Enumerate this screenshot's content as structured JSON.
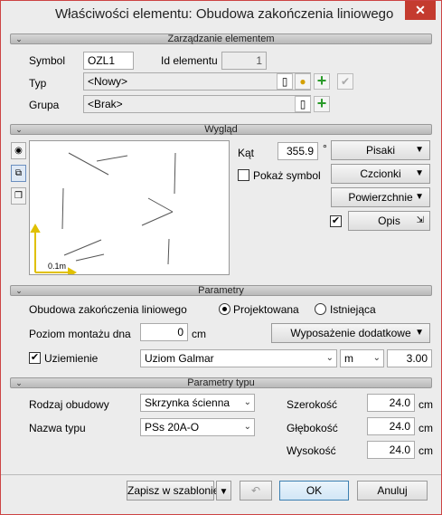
{
  "window": {
    "title": "Właściwości elementu: Obudowa zakończenia liniowego",
    "close": "✕"
  },
  "sections": {
    "management": "Zarządzanie elementem",
    "appearance": "Wygląd",
    "parameters": "Parametry",
    "type_parameters": "Parametry typu"
  },
  "management": {
    "symbol_label": "Symbol",
    "symbol_value": "OZL1",
    "id_label": "Id elementu",
    "id_value": "1",
    "type_label": "Typ",
    "type_value": "<Nowy>",
    "group_label": "Grupa",
    "group_value": "<Brak>"
  },
  "appearance": {
    "angle_label": "Kąt",
    "angle_value": "355.9",
    "angle_unit": "°",
    "show_symbol_label": "Pokaż symbol",
    "show_symbol_checked": false,
    "pens_button": "Pisaki",
    "fonts_button": "Czcionki",
    "surfaces_button": "Powierzchnie",
    "description_button": "Opis",
    "description_checked": true,
    "scale_label": "0.1m"
  },
  "parameters": {
    "enclosure_label": "Obudowa zakończenia liniowego",
    "radio_designed": "Projektowana",
    "radio_existing": "Istniejąca",
    "selected": "Projektowana",
    "mount_level_label": "Poziom montażu dna",
    "mount_level_value": "0",
    "mount_level_unit": "cm",
    "equipment_button": "Wyposażenie dodatkowe",
    "grounding_label": "Uziemienie",
    "grounding_checked": true,
    "grounding_value": "Uziom Galmar",
    "grounding_unit": "m",
    "grounding_length": "3.00"
  },
  "type_parameters": {
    "housing_label": "Rodzaj obudowy",
    "housing_value": "Skrzynka ścienna",
    "type_name_label": "Nazwa typu",
    "type_name_value": "PSs 20A-O",
    "width_label": "Szerokość",
    "width_value": "24.0",
    "depth_label": "Głębokość",
    "depth_value": "24.0",
    "height_label": "Wysokość",
    "height_value": "24.0",
    "unit": "cm"
  },
  "footer": {
    "save_template": "Zapisz w szablonie",
    "ok": "OK",
    "cancel": "Anuluj"
  }
}
